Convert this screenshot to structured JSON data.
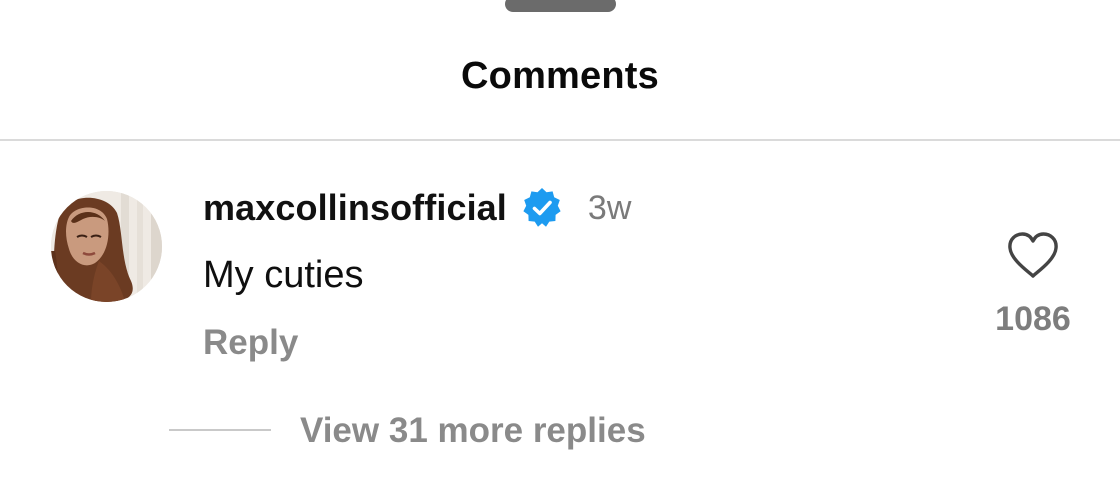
{
  "header": {
    "title": "Comments"
  },
  "comment": {
    "username": "maxcollinsofficial",
    "verified": true,
    "timestamp": "3w",
    "text": "My cuties",
    "reply_label": "Reply",
    "like_count": "1086",
    "view_replies_label": "View 31 more replies"
  },
  "icons": {
    "verified": "verified-badge-icon",
    "like": "heart-outline-icon",
    "handle": "drag-handle"
  },
  "colors": {
    "verified_blue": "#1d9bf0",
    "muted_text": "#8a8a8a",
    "divider": "#dadada"
  }
}
